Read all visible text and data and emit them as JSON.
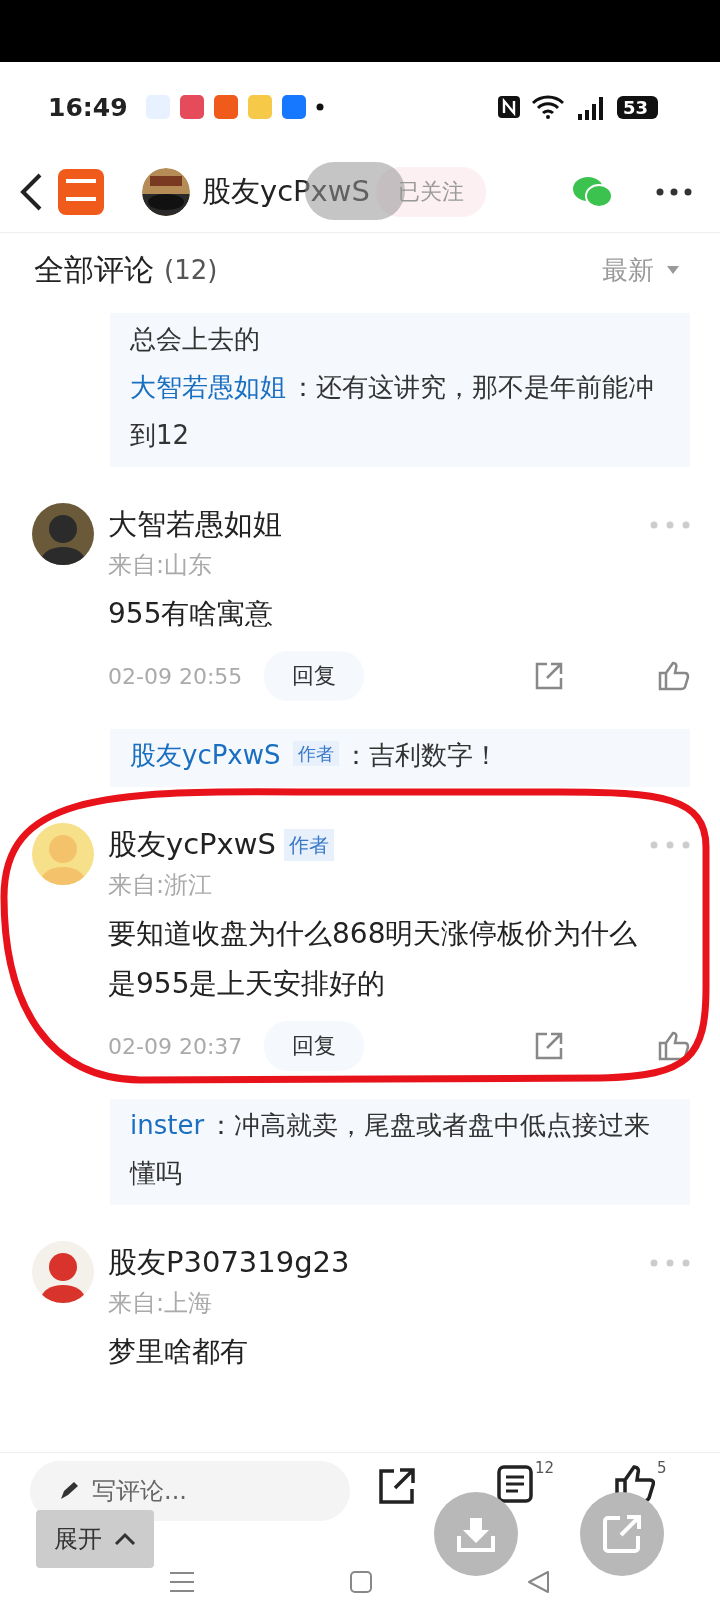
{
  "status_bar": {
    "time": "16:49",
    "battery": "53"
  },
  "header": {
    "author": "股友ycPxwS",
    "follow_button": "已关注"
  },
  "comments_header": {
    "title": "全部评论",
    "count": "(12)",
    "sort": "最新"
  },
  "items": [
    {
      "kind": "replies",
      "replies": [
        {
          "text": "总会上去的"
        },
        {
          "user": "大智若愚如姐",
          "text": "：还有这讲究，那不是年前能冲到12"
        }
      ]
    },
    {
      "kind": "comment",
      "user": "大智若愚如姐",
      "location": "来自:山东",
      "text": "955有啥寓意",
      "time": "02-09 20:55",
      "reply_button": "回复",
      "annotated": false
    },
    {
      "kind": "replies",
      "replies": [
        {
          "user": "股友ycPxwS",
          "badge": "作者",
          "text": "：吉利数字！"
        }
      ]
    },
    {
      "kind": "comment",
      "user": "股友ycPxwS",
      "badge": "作者",
      "location": "来自:浙江",
      "text": "要知道收盘为什么868明天涨停板价为什么是955是上天安排好的",
      "time": "02-09 20:37",
      "reply_button": "回复",
      "annotated": true
    },
    {
      "kind": "replies",
      "replies": [
        {
          "user": "inster",
          "text": "：冲高就卖，尾盘或者盘中低点接过来懂吗"
        }
      ]
    },
    {
      "kind": "comment",
      "user": "股友P307319g23",
      "location": "来自:上海",
      "text": "梦里啥都有",
      "annotated": false
    }
  ],
  "bottom_bar": {
    "comment_placeholder": "写评论...",
    "comment_count": "12",
    "like_count": "5"
  },
  "expand_button": "展开"
}
